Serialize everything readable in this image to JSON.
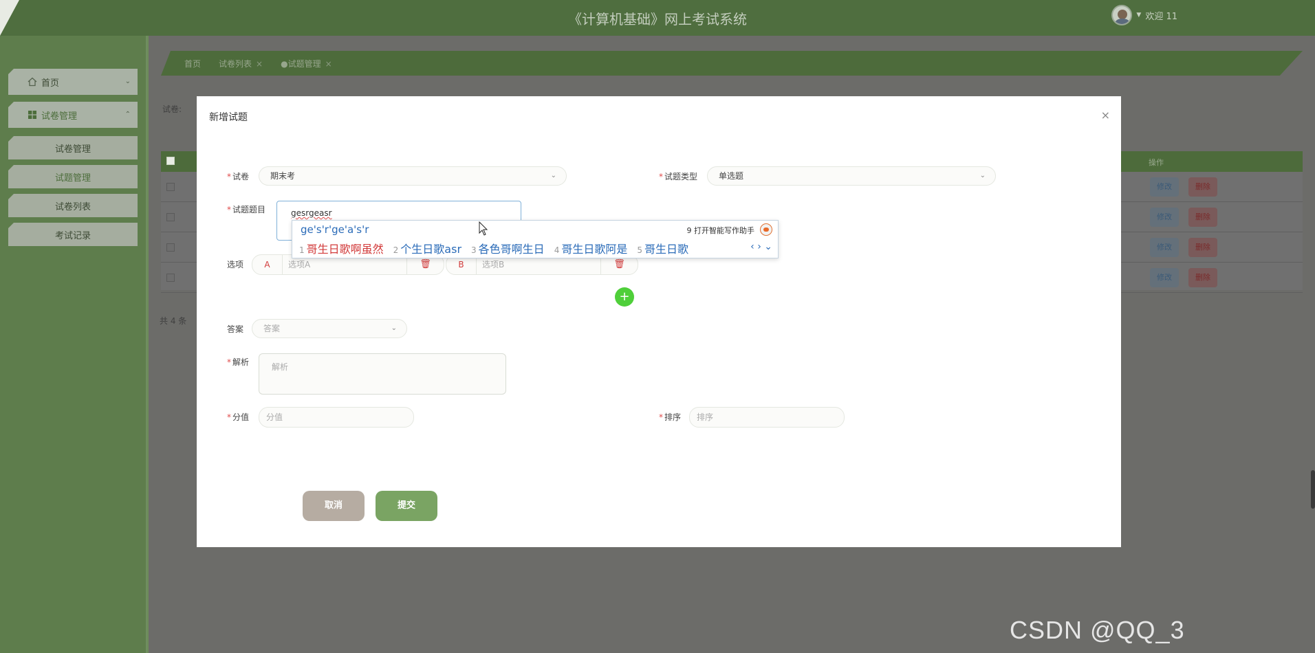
{
  "header": {
    "app_title": "《计算机基础》网上考试系统",
    "welcome": "欢迎 11"
  },
  "sidebar": {
    "items": [
      {
        "label": "首页"
      },
      {
        "label": "试卷管理"
      }
    ],
    "sub_items": [
      {
        "label": "试卷管理"
      },
      {
        "label": "试题管理"
      },
      {
        "label": "试卷列表"
      },
      {
        "label": "考试记录"
      }
    ]
  },
  "tabs": [
    {
      "label": "首页"
    },
    {
      "label": "试卷列表"
    },
    {
      "label": "●试题管理"
    }
  ],
  "background": {
    "filter_label": "试卷:",
    "op_header": "操作",
    "edit_label": "修改",
    "delete_label": "删除",
    "total_label": "共 4 条"
  },
  "modal": {
    "title": "新增试题",
    "close": "×",
    "paper_label": "试卷",
    "paper_value": "期末考",
    "type_label": "试题类型",
    "type_value": "单选题",
    "question_label": "试题题目",
    "question_value": "gesrgeasr",
    "options_label": "选项",
    "option_a_letter": "A",
    "option_a_placeholder": "选项A",
    "option_b_letter": "B",
    "option_b_placeholder": "选项B",
    "add_symbol": "+",
    "answer_label": "答案",
    "answer_placeholder": "答案",
    "analysis_label": "解析",
    "analysis_placeholder": "解析",
    "score_label": "分值",
    "score_placeholder": "分值",
    "order_label": "排序",
    "order_placeholder": "排序",
    "cancel_label": "取消",
    "submit_label": "提交"
  },
  "ime": {
    "composition": "ge's'r'ge'a's'r",
    "hint": "9 打开智能写作助手",
    "candidates": [
      {
        "num": "1",
        "text": "哥生日歌啊虽然"
      },
      {
        "num": "2",
        "text": "个生日歌asr"
      },
      {
        "num": "3",
        "text": "各色哥啊生日"
      },
      {
        "num": "4",
        "text": "哥生日歌阿是"
      },
      {
        "num": "5",
        "text": "哥生日歌"
      }
    ],
    "nav": "‹ › ⌄"
  },
  "watermark": "CSDN @QQ_3",
  "colors": {
    "header": "#4f6e3f",
    "accent_green": "#7aa463",
    "danger": "#d23a3a",
    "ime_blue": "#2a6bb8"
  },
  "icons": [
    "home-icon",
    "grid-icon",
    "chevron-down-icon",
    "chevron-up-icon",
    "close-icon",
    "trash-icon",
    "plus-icon",
    "mouse-cursor-icon"
  ]
}
